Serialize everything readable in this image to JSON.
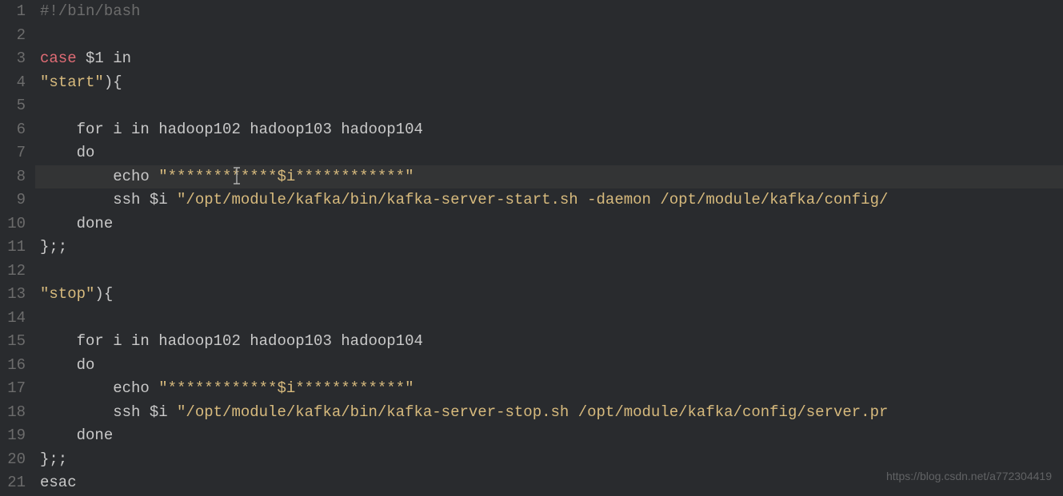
{
  "lines": [
    {
      "n": "1",
      "segs": [
        {
          "cls": "comment",
          "t": "#!/bin/bash"
        }
      ]
    },
    {
      "n": "2",
      "segs": []
    },
    {
      "n": "3",
      "segs": [
        {
          "cls": "keyword",
          "t": "case"
        },
        {
          "cls": "var",
          "t": " $1 in"
        }
      ]
    },
    {
      "n": "4",
      "segs": [
        {
          "cls": "string",
          "t": "\"start\""
        },
        {
          "cls": "var",
          "t": "){"
        }
      ]
    },
    {
      "n": "5",
      "segs": []
    },
    {
      "n": "6",
      "segs": [
        {
          "cls": "var",
          "t": "    for i in hadoop102 hadoop103 hadoop104"
        }
      ]
    },
    {
      "n": "7",
      "segs": [
        {
          "cls": "var",
          "t": "    do"
        }
      ]
    },
    {
      "n": "8",
      "segs": [
        {
          "cls": "var",
          "t": "        echo "
        },
        {
          "cls": "string",
          "t": "\"************$i************\""
        }
      ]
    },
    {
      "n": "9",
      "segs": [
        {
          "cls": "var",
          "t": "        ssh $i "
        },
        {
          "cls": "string",
          "t": "\"/opt/module/kafka/bin/kafka-server-start.sh -daemon /opt/module/kafka/config/"
        }
      ]
    },
    {
      "n": "10",
      "segs": [
        {
          "cls": "var",
          "t": "    done"
        }
      ]
    },
    {
      "n": "11",
      "segs": [
        {
          "cls": "var",
          "t": "};;"
        }
      ]
    },
    {
      "n": "12",
      "segs": []
    },
    {
      "n": "13",
      "segs": [
        {
          "cls": "string",
          "t": "\"stop\""
        },
        {
          "cls": "var",
          "t": "){"
        }
      ]
    },
    {
      "n": "14",
      "segs": []
    },
    {
      "n": "15",
      "segs": [
        {
          "cls": "var",
          "t": "    for i in hadoop102 hadoop103 hadoop104"
        }
      ]
    },
    {
      "n": "16",
      "segs": [
        {
          "cls": "var",
          "t": "    do"
        }
      ]
    },
    {
      "n": "17",
      "segs": [
        {
          "cls": "var",
          "t": "        echo "
        },
        {
          "cls": "string",
          "t": "\"************$i************\""
        }
      ]
    },
    {
      "n": "18",
      "segs": [
        {
          "cls": "var",
          "t": "        ssh $i "
        },
        {
          "cls": "string",
          "t": "\"/opt/module/kafka/bin/kafka-server-stop.sh /opt/module/kafka/config/server.pr"
        }
      ]
    },
    {
      "n": "19",
      "segs": [
        {
          "cls": "var",
          "t": "    done"
        }
      ]
    },
    {
      "n": "20",
      "segs": [
        {
          "cls": "var",
          "t": "};;"
        }
      ]
    },
    {
      "n": "21",
      "segs": [
        {
          "cls": "var",
          "t": "esac"
        }
      ]
    }
  ],
  "active_line_index": 7,
  "watermark": "https://blog.csdn.net/a772304419"
}
